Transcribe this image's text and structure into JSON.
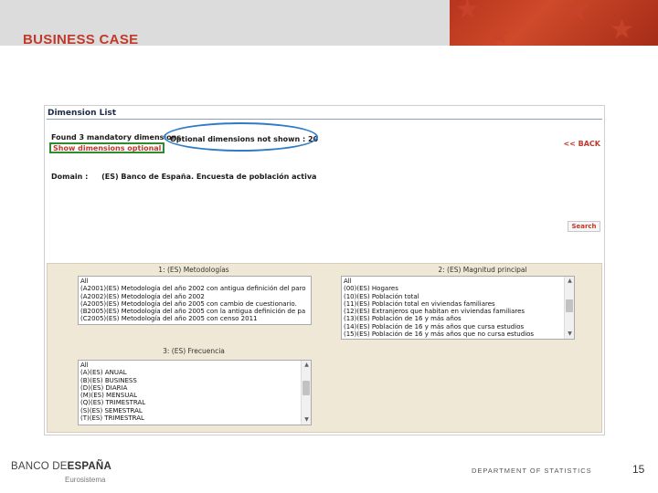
{
  "slide": {
    "title": "BUSINESS CASE",
    "logo_prefix": "BANCO DE",
    "logo_bold": "ESPAÑA",
    "logo_sub": "Eurosistema",
    "department": "DEPARTMENT OF STATISTICS",
    "page_number": "15",
    "brand_color": "#c0392b"
  },
  "app": {
    "header": "Dimension List",
    "found_text": "Found 3 mandatory dimensions",
    "optional_not_shown": "Optional dimensions not shown : 20",
    "show_optional_link": "Show dimensions optional",
    "back_link": "<< BACK",
    "domain_label": "Domain :",
    "domain_value": "(ES) Banco de España. Encuesta de población activa",
    "search_button": "Search"
  },
  "lists": {
    "metodologias": {
      "title": "1: (ES) Metodologías",
      "items": [
        "All",
        "(A2001)(ES) Metodología del año 2002 con antigua definición del paro",
        "(A2002)(ES) Metodología del año 2002",
        "(A2005)(ES) Metodología del año 2005 con cambio de cuestionario.",
        "(B2005)(ES) Metodología del año 2005 con la antigua definición de pa",
        "(C2005)(ES) Metodología del año 2005 con censo 2011"
      ]
    },
    "magnitud": {
      "title": "2: (ES) Magnitud principal",
      "items": [
        "All",
        "(00)(ES) Hogares",
        "(10)(ES) Población total",
        "(11)(ES) Población total en viviendas familiares",
        "(12)(ES) Extranjeros que habitan en viviendas familiares",
        "(13)(ES) Población de 16 y más años",
        "(14)(ES) Población de 16 y más años que cursa estudios",
        "(15)(ES) Población de 16 y más años que no cursa estudios"
      ]
    },
    "frecuencia": {
      "title": "3: (ES) Frecuencia",
      "items": [
        "All",
        "(A)(ES) ANUAL",
        "(B)(ES) BUSINESS",
        "(D)(ES) DIARIA",
        "(M)(ES) MENSUAL",
        "(Q)(ES) TRIMESTRAL",
        "(S)(ES) SEMESTRAL",
        "(T)(ES) TRIMESTRAL"
      ]
    }
  },
  "icons": {
    "scroll_up": "up-arrow-icon",
    "scroll_down": "down-arrow-icon",
    "star": "star-icon"
  }
}
